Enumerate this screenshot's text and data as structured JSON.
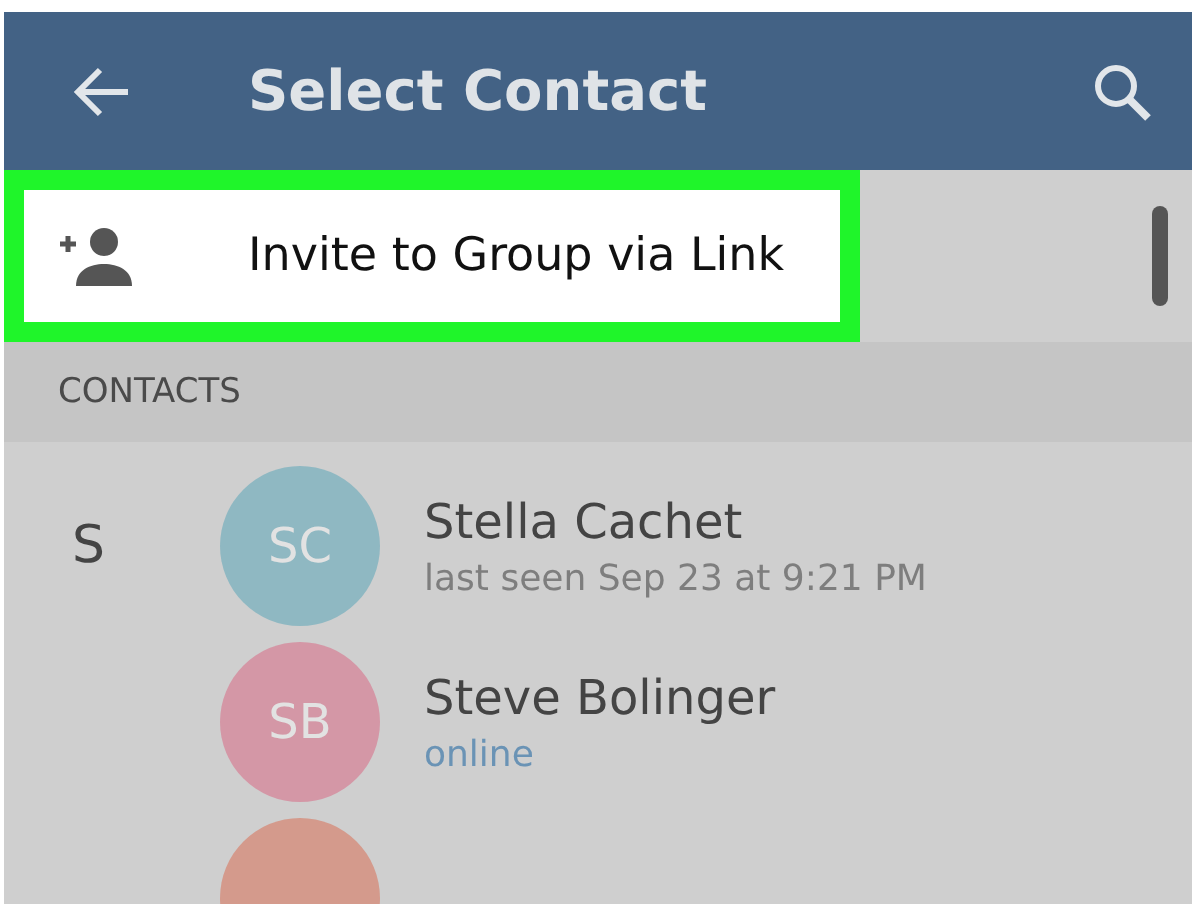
{
  "header": {
    "title": "Select Contact"
  },
  "invite": {
    "label": "Invite to Group via Link",
    "highlighted": true
  },
  "section": {
    "title": "CONTACTS"
  },
  "contacts": [
    {
      "letter": "S",
      "initials": "SC",
      "color": "#8fb8c2",
      "name": "Stella Cachet",
      "status": "last seen Sep 23 at 9:21 PM",
      "online": false
    },
    {
      "initials": "SB",
      "color": "#d497a6",
      "name": "Steve Bolinger",
      "status": "online",
      "online": true
    },
    {
      "color": "#d49a8c"
    }
  ]
}
